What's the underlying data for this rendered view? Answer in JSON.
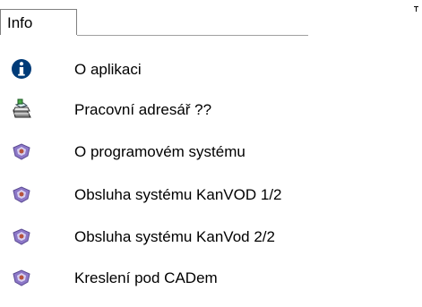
{
  "menu": {
    "title": "Info",
    "items": [
      {
        "label": "O aplikaci",
        "icon": "info-circle-icon"
      },
      {
        "label": "Pracovní adresář ??",
        "icon": "printer-folder-icon"
      },
      {
        "label": "O programovém systému",
        "icon": "system-gem-icon"
      },
      {
        "label": "Obsluha systému KanVOD 1/2",
        "icon": "system-gem-icon"
      },
      {
        "label": "Obsluha systému KanVod 2/2",
        "icon": "system-gem-icon"
      },
      {
        "label": "Kreslení pod CADem",
        "icon": "system-gem-icon"
      }
    ]
  },
  "colors": {
    "info_icon": "#003b78",
    "gem_icon": "#7b65b5",
    "border": "#808080"
  }
}
